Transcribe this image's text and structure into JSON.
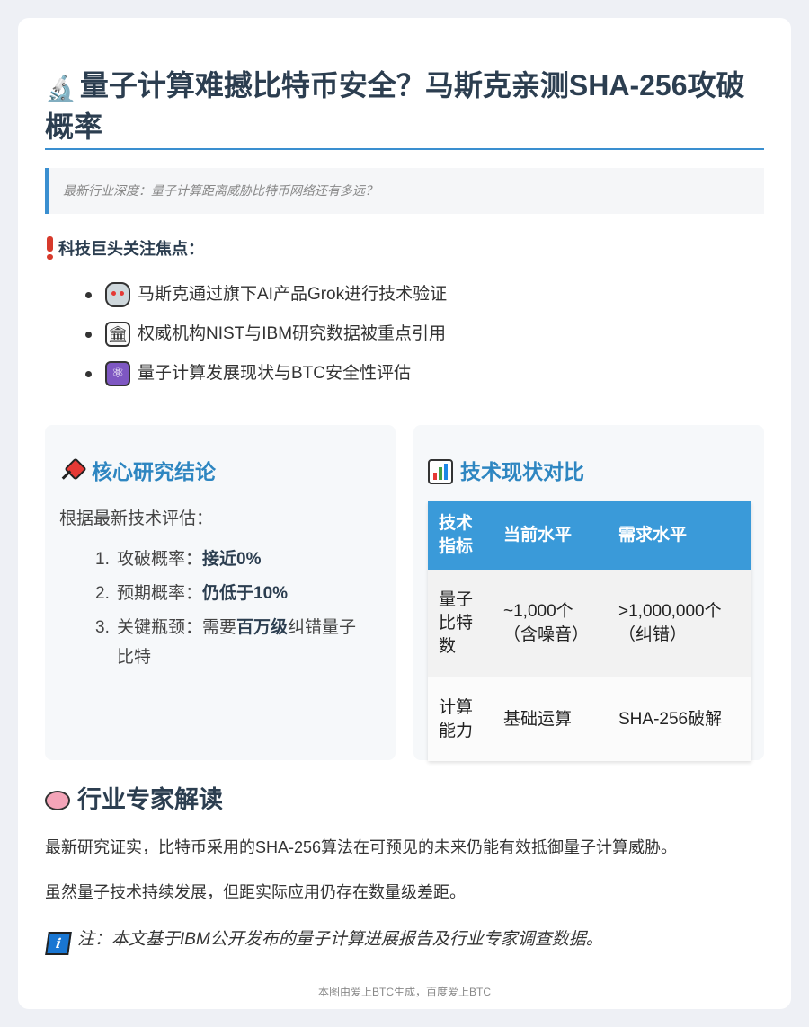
{
  "header": {
    "title_icon": "microscope-icon",
    "title": "量子计算难撼比特币安全？马斯克亲测SHA-256攻破概率",
    "subtitle": "最新行业深度：量子计算距离威胁比特币网络还有多远？"
  },
  "focus": {
    "heading": "科技巨头关注焦点：",
    "heading_icon": "exclamation-icon",
    "items": [
      {
        "icon": "robot-icon",
        "text": "马斯克通过旗下AI产品Grok进行技术验证"
      },
      {
        "icon": "bank-icon",
        "text": "权威机构NIST与IBM研究数据被重点引用"
      },
      {
        "icon": "atom-icon",
        "text": "量子计算发展现状与BTC安全性评估"
      }
    ]
  },
  "conclusion": {
    "heading_icon": "pushpin-icon",
    "heading": "核心研究结论",
    "intro": "根据最新技术评估：",
    "items": [
      {
        "num": "1.",
        "label": "攻破概率：",
        "strong": "接近0%",
        "rest": ""
      },
      {
        "num": "2.",
        "label": "预期概率：",
        "strong": "仍低于10%",
        "rest": ""
      },
      {
        "num": "3.",
        "label": "关键瓶颈：需要",
        "strong": "百万级",
        "rest": "纠错量子比特"
      }
    ]
  },
  "comparison": {
    "heading_icon": "bar-chart-icon",
    "heading": "技术现状对比",
    "columns": [
      "技术指标",
      "当前水平",
      "需求水平"
    ],
    "rows": [
      [
        "量子比特数",
        "~1,000个（含噪音）",
        ">1,000,000个（纠错）"
      ],
      [
        "计算能力",
        "基础运算",
        "SHA-256破解"
      ]
    ]
  },
  "expert": {
    "heading_icon": "brain-icon",
    "heading": "行业专家解读",
    "p1": "最新研究证实，比特币采用的SHA-256算法在可预见的未来仍能有效抵御量子计算威胁。",
    "p2": "虽然量子技术持续发展，但距实际应用仍存在数量级差距。",
    "note_icon": "info-icon",
    "note": "注：本文基于IBM公开发布的量子计算进展报告及行业专家调查数据。"
  },
  "footer": "本图由爱上BTC生成，百度爱上BTC",
  "colors": {
    "accent": "#3a8fd0",
    "panel_title": "#2e86c1",
    "table_header": "#3a9ad9"
  }
}
